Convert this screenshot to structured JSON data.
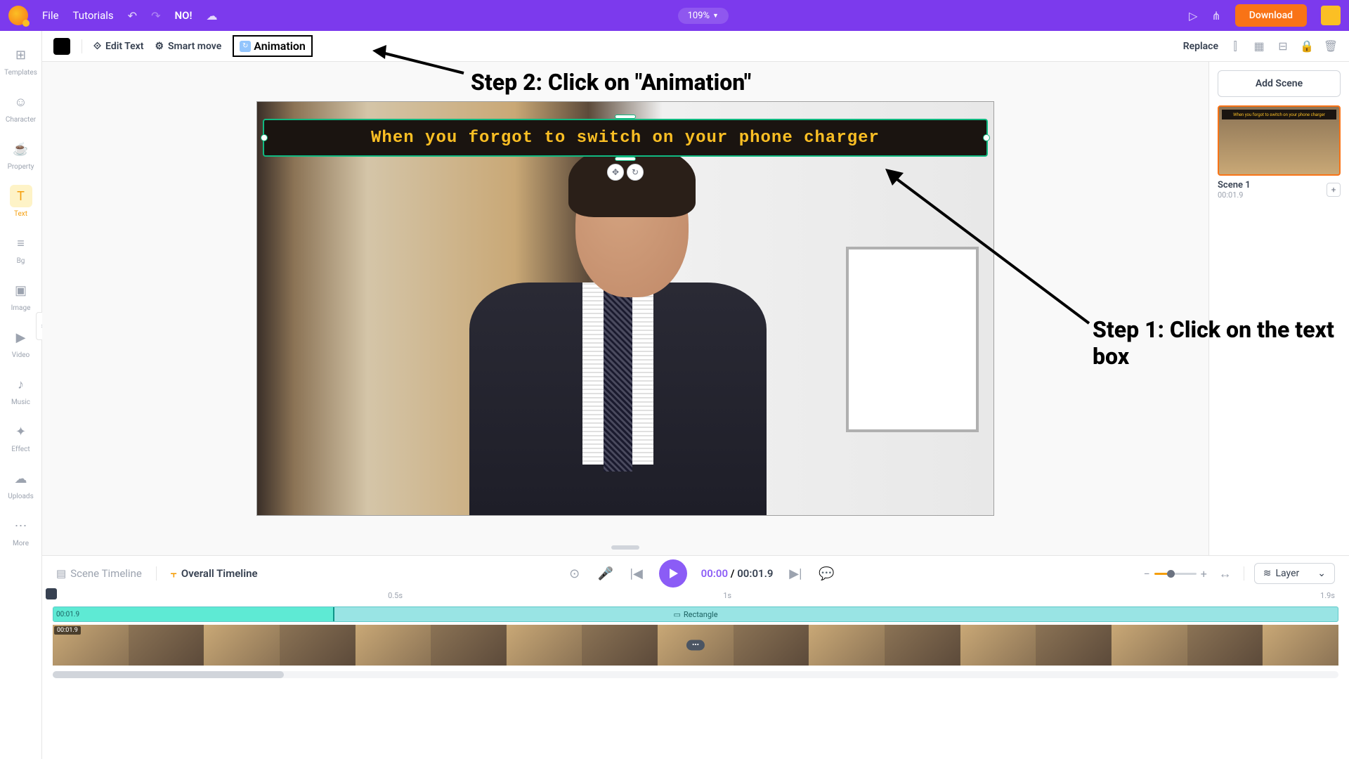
{
  "topbar": {
    "file": "File",
    "tutorials": "Tutorials",
    "title": "NO!",
    "zoom": "109%",
    "download": "Download"
  },
  "sidebar": {
    "items": [
      {
        "label": "Templates",
        "icon": "⊞"
      },
      {
        "label": "Character",
        "icon": "☺"
      },
      {
        "label": "Property",
        "icon": "☕"
      },
      {
        "label": "Text",
        "icon": "T"
      },
      {
        "label": "Bg",
        "icon": "≡"
      },
      {
        "label": "Image",
        "icon": "▣"
      },
      {
        "label": "Video",
        "icon": "▶"
      },
      {
        "label": "Music",
        "icon": "♪"
      },
      {
        "label": "Effect",
        "icon": "✦"
      },
      {
        "label": "Uploads",
        "icon": "☁"
      },
      {
        "label": "More",
        "icon": "⋯"
      }
    ]
  },
  "context": {
    "edit_text": "Edit Text",
    "smart_move": "Smart move",
    "animation": "Animation",
    "replace": "Replace"
  },
  "canvas": {
    "caption": "When you forgot to switch on your phone charger"
  },
  "scene_panel": {
    "add_scene": "Add Scene",
    "scene1_name": "Scene 1",
    "scene1_time": "00:01.9"
  },
  "annotations": {
    "step1": "Step 1: Click on the text box",
    "step2": "Step 2: Click on \"Animation\""
  },
  "timeline": {
    "scene_tab": "Scene Timeline",
    "overall_tab": "Overall Timeline",
    "current": "00:00",
    "total": "00:01.9",
    "layer": "Layer",
    "ruler": {
      "m1": "0.5s",
      "m2": "1s",
      "m3": "1.9s"
    },
    "text_track_time": "00:01.9",
    "text_track_label": "Rectangle",
    "video_track_time": "00:01.9"
  }
}
